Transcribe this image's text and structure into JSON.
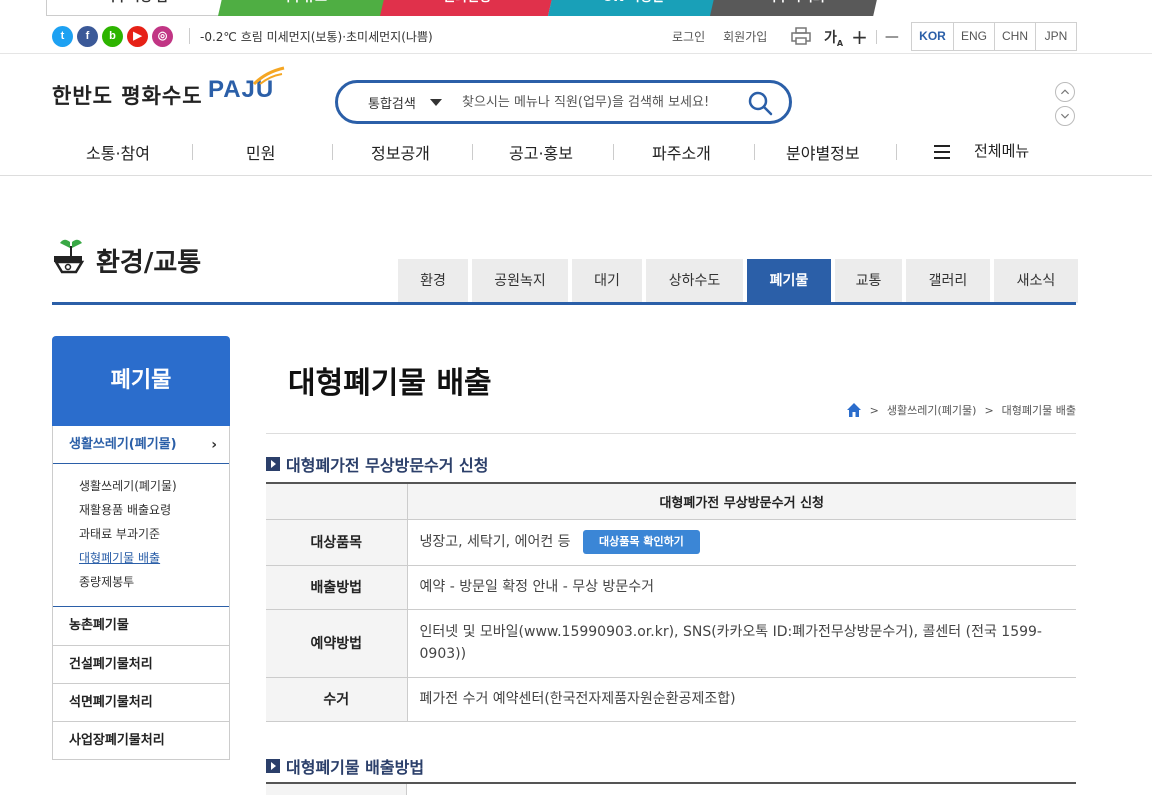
{
  "site_tabs": [
    "파주시청 홈",
    "파주뉴스",
    "문화관광",
    "OK 시청실",
    "파주시의회"
  ],
  "utility": {
    "sns": [
      "t",
      "f",
      "b",
      "▶",
      "◎"
    ],
    "weather": "-0.2℃ 흐림 미세먼지(보통)·초미세먼지(나쁨)",
    "login": "로그인",
    "signup": "회원가입",
    "font_label": "가",
    "font_sub": "A",
    "plus": "+",
    "minus": "—",
    "languages": [
      "KOR",
      "ENG",
      "CHN",
      "JPN"
    ]
  },
  "header": {
    "logo_text": "한반도 평화수도",
    "logo_brand": "PAJU",
    "search_category": "통합검색",
    "search_placeholder": "찾으시는 메뉴나 직원(업무)을 검색해 보세요!"
  },
  "gnb": [
    "소통·참여",
    "민원",
    "정보공개",
    "공고·홍보",
    "파주소개",
    "분야별정보"
  ],
  "gnb_all": "전체메뉴",
  "section": {
    "title": "환경/교통",
    "tabs": [
      {
        "label": "환경",
        "w": 70
      },
      {
        "label": "공원녹지",
        "w": 96
      },
      {
        "label": "대기",
        "w": 70
      },
      {
        "label": "상하수도",
        "w": 97
      },
      {
        "label": "폐기물",
        "w": 84,
        "active": true
      },
      {
        "label": "교통",
        "w": 67
      },
      {
        "label": "갤러리",
        "w": 84
      },
      {
        "label": "새소식",
        "w": 84
      }
    ]
  },
  "lnb": {
    "title": "폐기물",
    "open_item": "생활쓰레기(폐기물)",
    "open_arrow": "›",
    "sub_items": [
      "생활쓰레기(폐기물)",
      "재활용품 배출요령",
      "과태료 부과기준",
      "대형폐기물 배출",
      "종량제봉투"
    ],
    "active_sub": 3,
    "items": [
      "농촌폐기물",
      "건설폐기물처리",
      "석면폐기물처리",
      "사업장폐기물처리"
    ]
  },
  "page": {
    "title": "대형폐기물 배출",
    "breadcrumb_sep": ">",
    "breadcrumb": [
      "생활쓰레기(폐기물)",
      "대형폐기물 배출"
    ],
    "section1_title": "대형폐가전 무상방문수거 신청",
    "table_header": "대형폐가전 무상방문수거 신청",
    "rows": [
      {
        "th": "대상품목",
        "td": "냉장고, 세탁기, 에어컨 등",
        "button": "대상품목 확인하기"
      },
      {
        "th": "배출방법",
        "td": "예약 - 방문일 확정 안내 - 무상 방문수거"
      },
      {
        "th": "예약방법",
        "td": "인터넷 및 모바일(www.15990903.or.kr), SNS(카카오톡 ID:폐가전무상방문수거), 콜센터 (전국 1599-0903))"
      },
      {
        "th": "수거",
        "td": "폐가전 수거 예약센터(한국전자제품자원순환공제조합)"
      }
    ],
    "section2_title": "대형폐기물 배출방법"
  }
}
